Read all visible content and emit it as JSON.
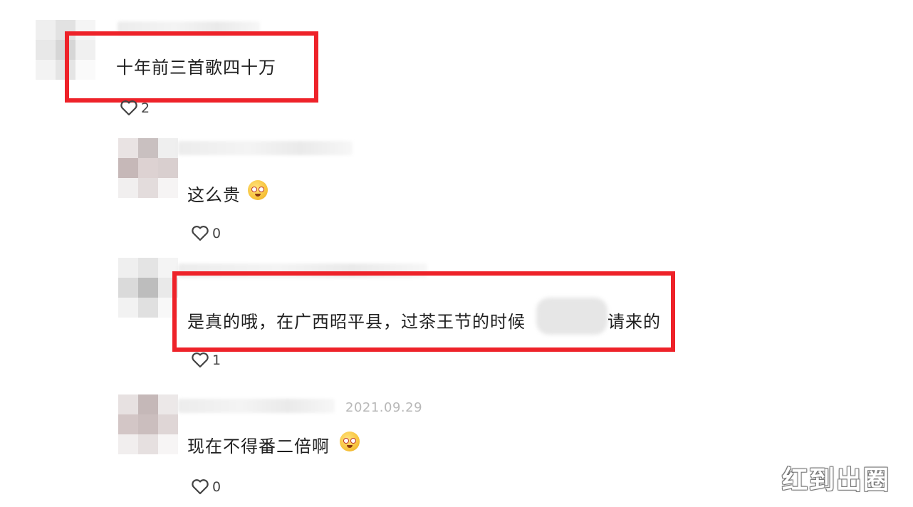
{
  "comments": [
    {
      "text": "十年前三首歌四十万",
      "likes": "2",
      "highlighted": true
    },
    {
      "text": "这么贵",
      "likes": "0",
      "emoji": "face-holding-back-tears-emoji"
    },
    {
      "text_before": "是真的哦，在广西昭平县，过茶王节的时候",
      "text_after": "请来的",
      "likes": "1",
      "highlighted": true
    },
    {
      "date": "2021.09.29",
      "text": "现在不得番二倍啊",
      "likes": "0",
      "emoji": "face-holding-back-tears-emoji"
    }
  ],
  "watermark": "红到出圈",
  "colors": {
    "highlight_border": "#ee2229",
    "timestamp": "#b8b8b8",
    "text": "#1f1f1f"
  }
}
